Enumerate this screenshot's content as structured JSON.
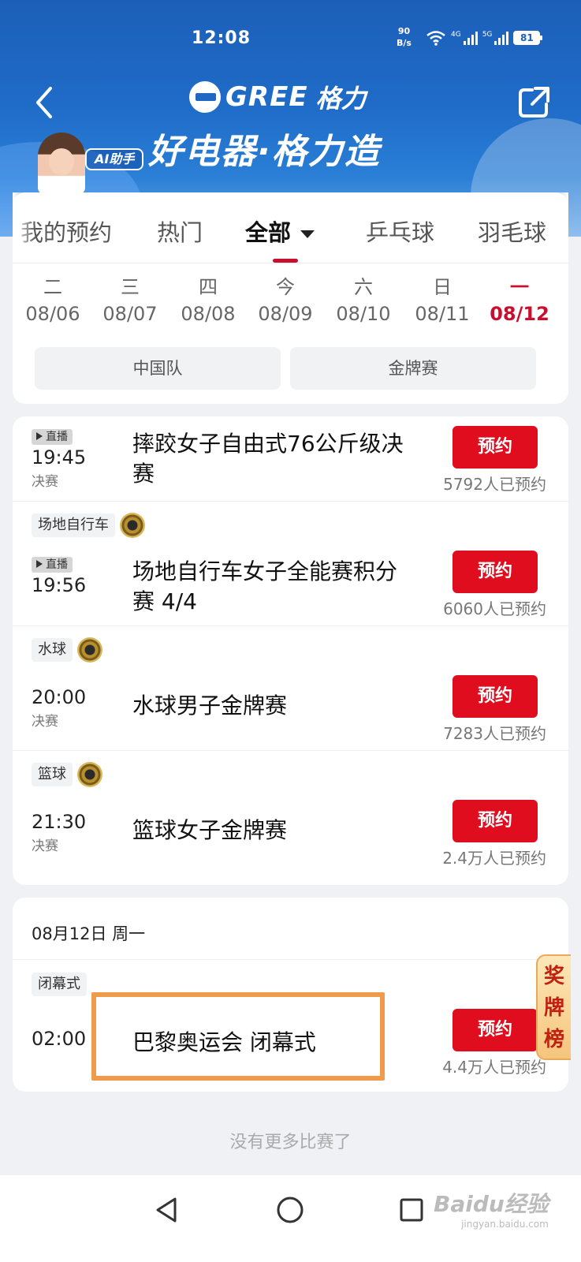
{
  "status_bar": {
    "time": "12:08",
    "net_speed_value": "90",
    "net_speed_unit": "B/s",
    "sim1_label": "4G",
    "sim2_label": "5G",
    "battery": "81"
  },
  "header": {
    "brand_latin": "GREE",
    "brand_cn": "格力",
    "slogan": "好电器·格力造",
    "ai_badge": "AI助手"
  },
  "tabs": [
    {
      "label": "我的预约"
    },
    {
      "label": "热门"
    },
    {
      "label": "全部"
    },
    {
      "label": "乒乓球"
    },
    {
      "label": "羽毛球"
    }
  ],
  "dates": [
    {
      "weekday": "二",
      "date": "08/06"
    },
    {
      "weekday": "三",
      "date": "08/07"
    },
    {
      "weekday": "四",
      "date": "08/08"
    },
    {
      "weekday": "今",
      "date": "08/09"
    },
    {
      "weekday": "六",
      "date": "08/10"
    },
    {
      "weekday": "日",
      "date": "08/11"
    },
    {
      "weekday": "一",
      "date": "08/12"
    }
  ],
  "filters": [
    "中国队",
    "金牌赛"
  ],
  "events": [
    {
      "live": "直播",
      "time": "19:45",
      "stage": "决赛",
      "title": "摔跤女子自由式76公斤级决赛",
      "button": "预约",
      "count": "5792人已预约"
    },
    {
      "sport": "场地自行车",
      "live": "直播",
      "time": "19:56",
      "stage": "",
      "title": "场地自行车女子全能赛积分赛 4/4",
      "button": "预约",
      "count": "6060人已预约"
    },
    {
      "sport": "水球",
      "time": "20:00",
      "stage": "决赛",
      "title": "水球男子金牌赛",
      "button": "预约",
      "count": "7283人已预约"
    },
    {
      "sport": "篮球",
      "time": "21:30",
      "stage": "决赛",
      "title": "篮球女子金牌赛",
      "button": "预约",
      "count": "2.4万人已预约"
    }
  ],
  "day_section": {
    "heading": "08月12日 周一",
    "event": {
      "sport": "闭幕式",
      "time": "02:00",
      "title": "巴黎奥运会 闭幕式",
      "button": "预约",
      "count": "4.4万人已预约"
    }
  },
  "award_tab": "奖牌榜",
  "footer": {
    "no_more": "没有更多比赛了"
  },
  "watermark": {
    "brand": "Baidu经验",
    "url": "jingyan.baidu.com"
  },
  "colors": {
    "accent_red": "#c8102e",
    "button_red": "#e00d1f",
    "header_blue": "#1f6cc8",
    "highlight_orange": "#f09a4b"
  }
}
